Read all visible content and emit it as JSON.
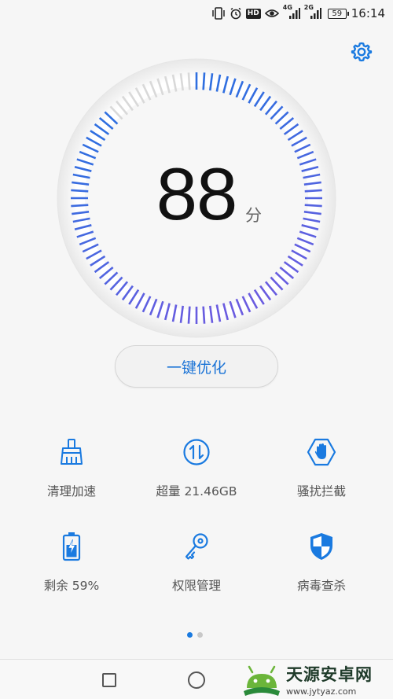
{
  "status_bar": {
    "time": "16:14",
    "battery": "59",
    "network_1": "4G",
    "network_2": "2G",
    "hd_label": "HD",
    "icons": [
      "vibrate-icon",
      "alarm-icon",
      "hd-icon",
      "eye-icon",
      "signal-icon",
      "signal-icon",
      "battery-icon"
    ]
  },
  "score": {
    "value": "88",
    "unit": "分",
    "gauge_fraction": 0.88
  },
  "colors": {
    "accent": "#1a73d6",
    "gauge_blue": "#2f6fe0",
    "gauge_purple": "#6b5ce0",
    "gauge_track": "#d9d9d9",
    "icon_blue": "#1a7ae0"
  },
  "optimize_button": {
    "label": "一键优化"
  },
  "features": [
    {
      "label": "清理加速",
      "icon": "broom-icon"
    },
    {
      "label": "超量 21.46GB",
      "icon": "data-transfer-icon"
    },
    {
      "label": "骚扰拦截",
      "icon": "hand-block-icon"
    },
    {
      "label": "剩余 59%",
      "icon": "battery-charging-icon"
    },
    {
      "label": "权限管理",
      "icon": "key-icon"
    },
    {
      "label": "病毒查杀",
      "icon": "shield-icon"
    }
  ],
  "pager": {
    "pages": 2,
    "current": 1
  },
  "watermark": {
    "title": "天源安卓网",
    "url": "www.jytyaz.com"
  }
}
